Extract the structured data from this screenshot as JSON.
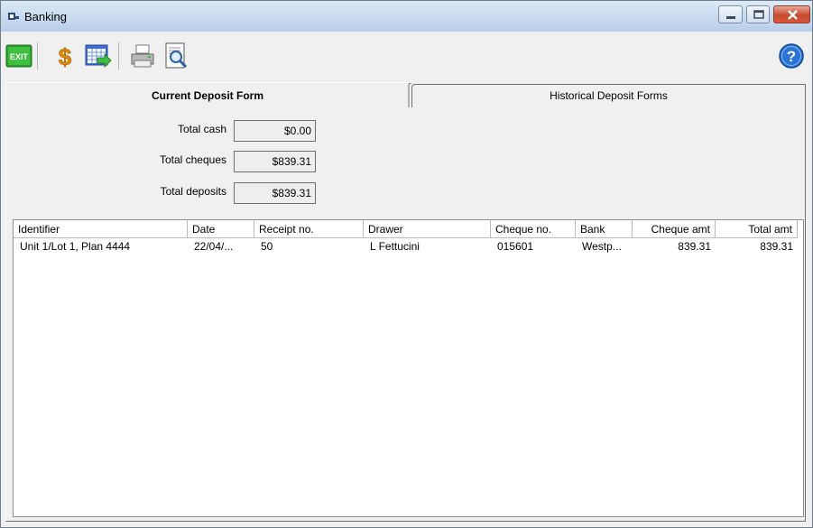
{
  "window": {
    "title": "Banking"
  },
  "toolbar": {
    "buttons": [
      "exit-button",
      "dollar-button",
      "grid-export-button",
      "print-button",
      "print-preview-button",
      "help-button"
    ],
    "exit_label": "EXIT"
  },
  "tabs": [
    {
      "label": "Current Deposit Form",
      "active": true
    },
    {
      "label": "Historical Deposit Forms",
      "active": false
    }
  ],
  "totals": {
    "cash_label": "Total cash",
    "cash_value": "$0.00",
    "cheques_label": "Total cheques",
    "cheques_value": "$839.31",
    "deposits_label": "Total deposits",
    "deposits_value": "$839.31"
  },
  "table": {
    "columns": [
      "Identifier",
      "Date",
      "Receipt no.",
      "Drawer",
      "Cheque no.",
      "Bank",
      "Cheque amt",
      "Total amt"
    ],
    "rows": [
      {
        "identifier": "Unit 1/Lot 1, Plan 4444",
        "date": "22/04/...",
        "receipt_no": "50",
        "drawer": "L Fettucini",
        "cheque_no": "015601",
        "bank": "Westp...",
        "cheque_amt": "839.31",
        "total_amt": "839.31"
      }
    ]
  },
  "colors": {
    "titlebar": "#c9dbef",
    "exit_green": "#2e9e2e",
    "dollar_orange": "#e08a00",
    "help_blue": "#2a74d8"
  }
}
